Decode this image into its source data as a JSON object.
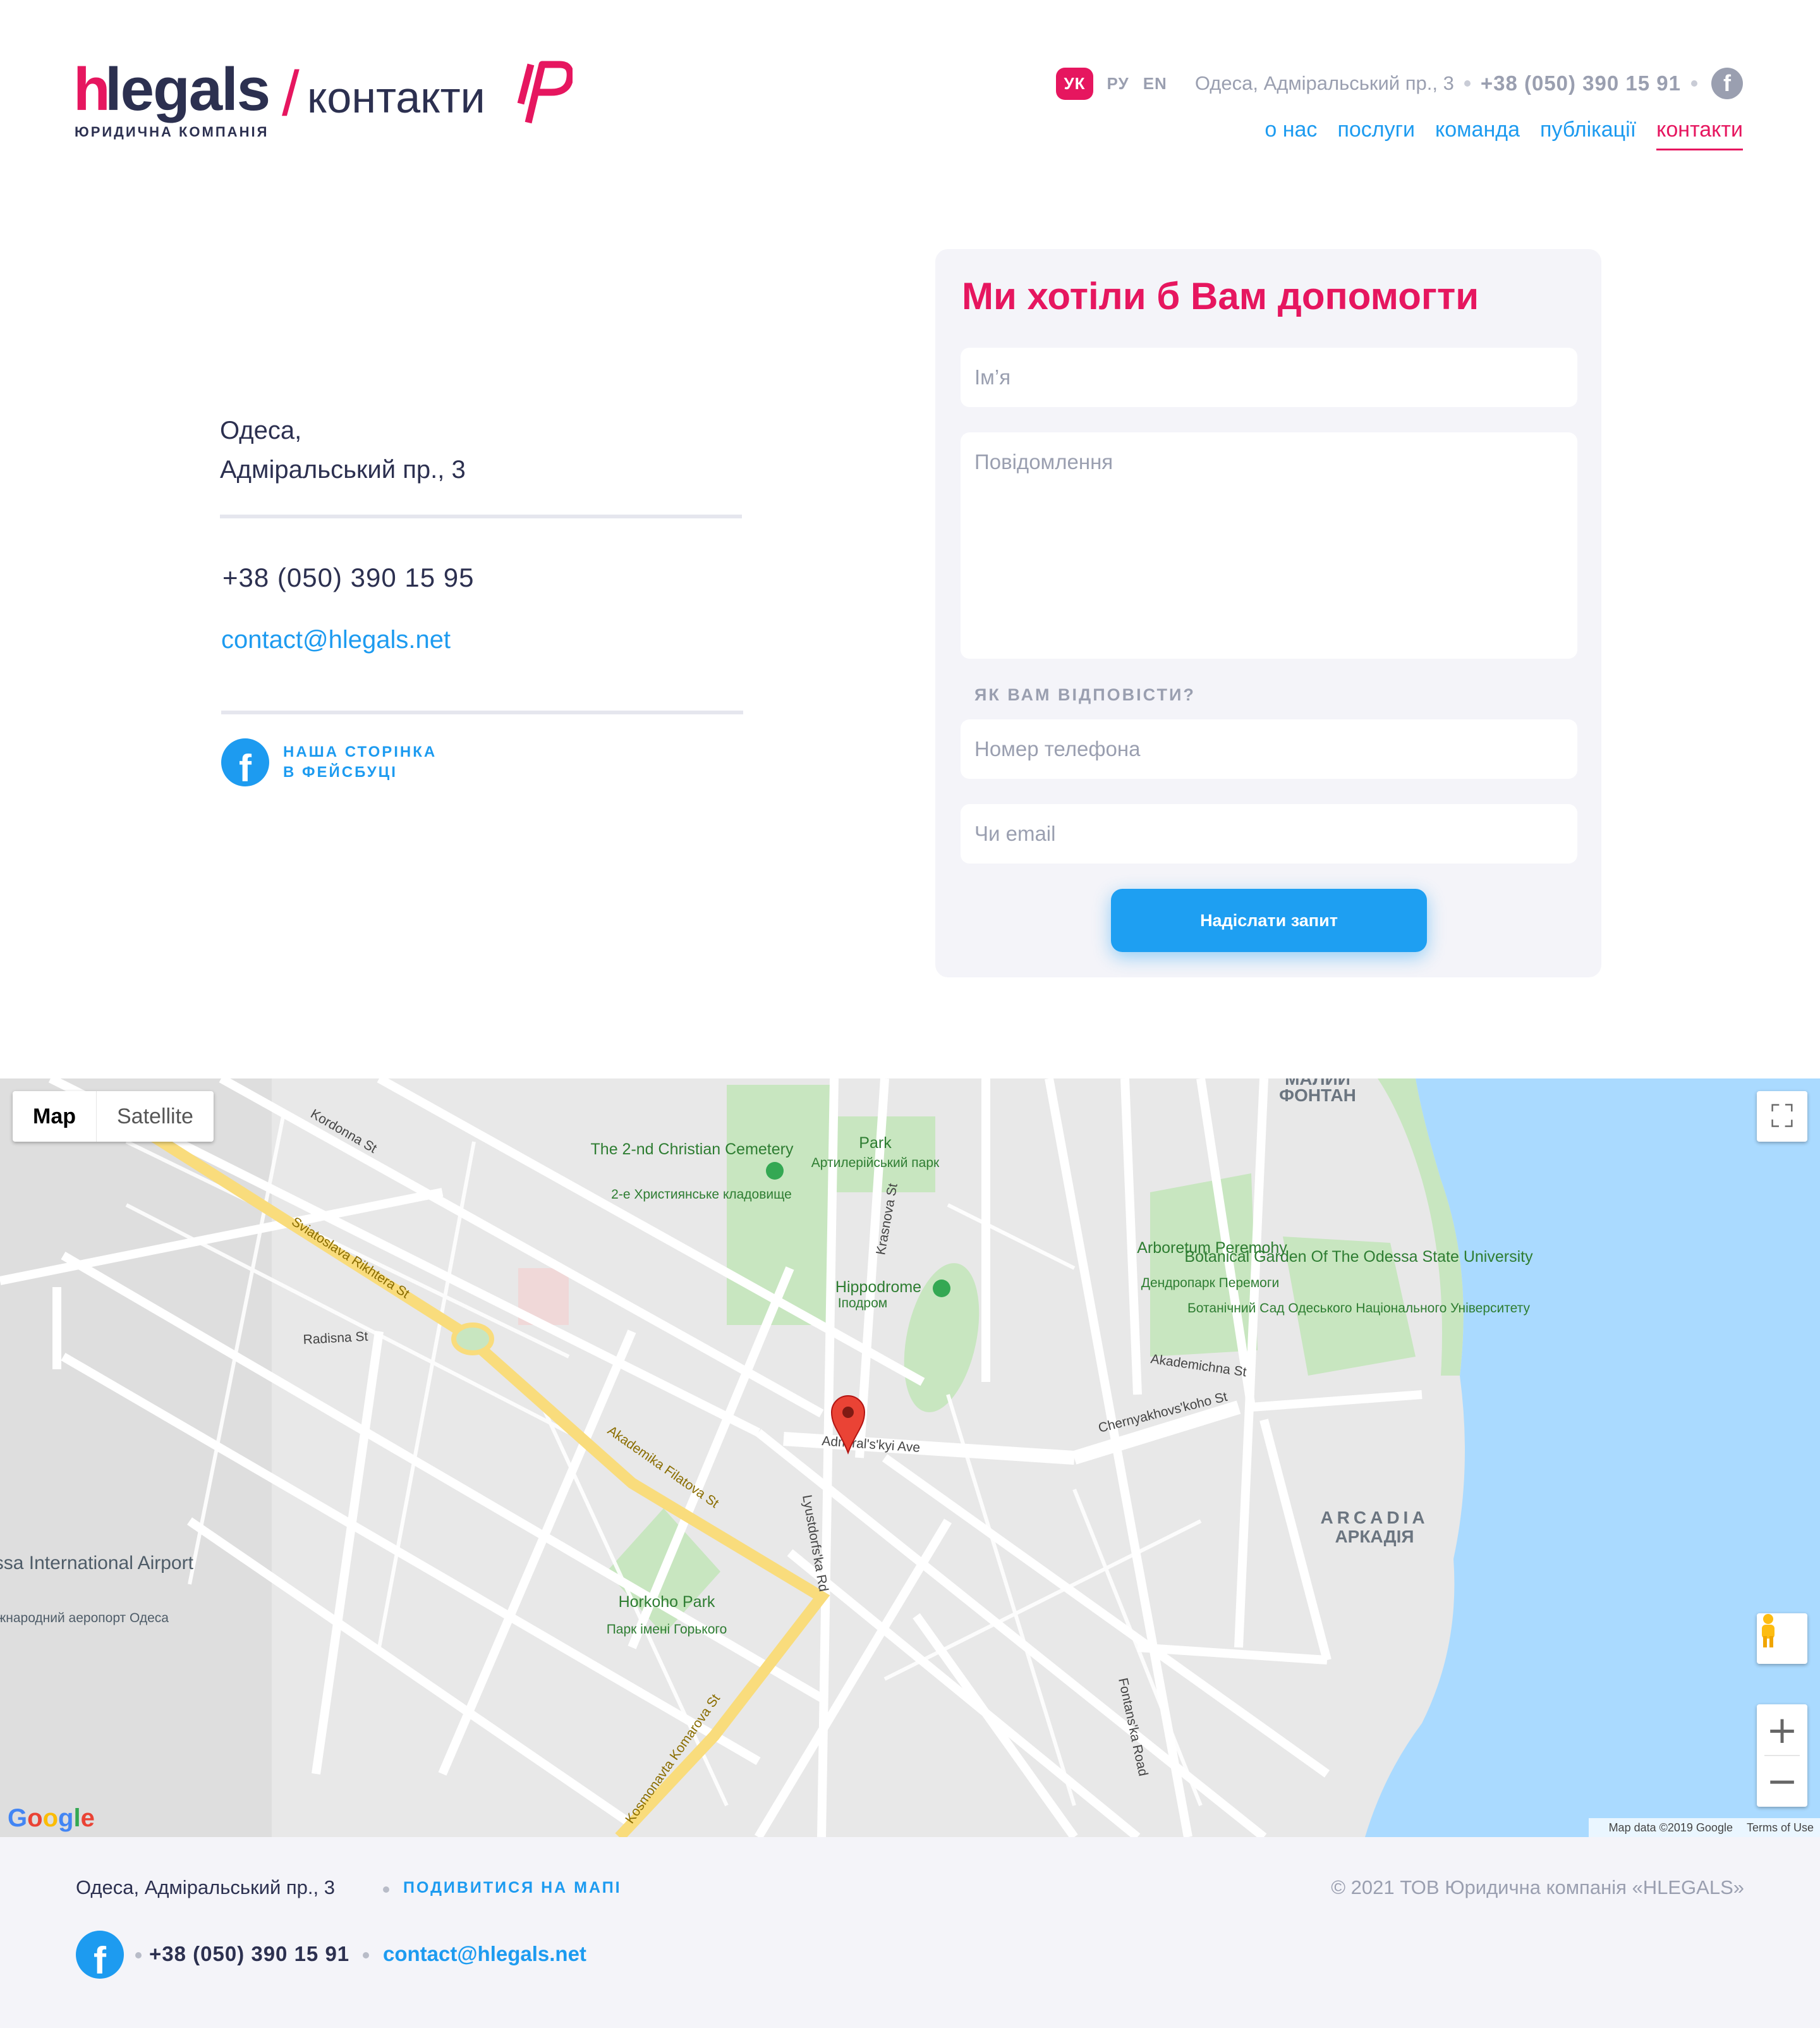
{
  "header": {
    "logo_h": "h",
    "logo_rest": "legals",
    "logo_slash": "/",
    "logo_section": "контакти",
    "logo_subtitle": "ЮРИДИЧНА КОМПАНІЯ",
    "languages": [
      {
        "code": "УК",
        "active": true
      },
      {
        "code": "РУ",
        "active": false
      },
      {
        "code": "EN",
        "active": false
      }
    ],
    "address": "Одеса, Адміральський пр., 3",
    "phone": "+38 (050) 390 15 91",
    "facebook_icon": "facebook-icon"
  },
  "nav": {
    "items": [
      {
        "label": "о нас",
        "active": false
      },
      {
        "label": "послуги",
        "active": false
      },
      {
        "label": "команда",
        "active": false
      },
      {
        "label": "публікації",
        "active": false
      },
      {
        "label": "контакти",
        "active": true
      }
    ]
  },
  "contact": {
    "address_line1": "Одеса,",
    "address_line2": "Адміральський пр., 3",
    "phone": "+38 (050) 390 15 95",
    "email": "contact@hlegals.net",
    "facebook_line1": "НАША СТОРІНКА",
    "facebook_line2": "В ФЕЙСБУЦІ"
  },
  "form": {
    "title": "Ми хотіли б Вам допомогти",
    "name_placeholder": "Ім’я",
    "message_placeholder": "Повідомлення",
    "reply_label": "ЯК ВАМ ВІДПОВІСТИ?",
    "phone_placeholder": "Номер телефона",
    "email_placeholder": "Чи email",
    "submit_label": "Надіслати запит"
  },
  "map": {
    "toggle_map": "Map",
    "toggle_satellite": "Satellite",
    "labels": {
      "cemetery": "The 2-nd Christian Cemetery",
      "cemetery_uk": "2-е Християнське кладовище",
      "park": "Park",
      "park_uk": "Артилерійський парк",
      "hippodrome": "Hippodrome",
      "hippodrome_uk": "Іподром",
      "arboretum": "Arboretum Peremohy",
      "arboretum_uk": "Дендропарк Перемоги",
      "botanical": "Botanical Garden Of The Odessa State University",
      "botanical_uk": "Ботанічний Сад Одеського Національного Університету",
      "fontan": "ФОНТАН",
      "malyi": "МАЛИЙ",
      "arcadia": "ARCADIA",
      "arcadia_uk": "АРКАДІЯ",
      "airport": "Odessa International Airport",
      "airport_uk": "Міжнародний аеропорт Одеса",
      "gorky": "Horkoho Park",
      "gorky_uk": "Парк імені Горького",
      "admiralskyi": "Admiral's'kyi Ave",
      "filatova": "Akademika Filatova St",
      "rikhtera": "Sviatoslava Rikhtera St",
      "komarova": "Kosmonavta Komarova St",
      "fontanska": "Fontans'ka Road",
      "kordonna": "Kordonna St",
      "radisna": "Radisna St",
      "chernyakhovs": "Chernyakhovs'koho St",
      "akademichna": "Akademichna St",
      "krasnova": "Krasnova St",
      "lyustdorfs": "Lyustdorfs'ka Rd"
    },
    "google": "Google",
    "map_data": "Map data ©2019 Google",
    "terms": "Terms of Use"
  },
  "footer": {
    "address": "Одеса, Адміральський пр., 3",
    "map_link": "ПОДИВИТИСЯ НА МАПІ",
    "copyright": "© 2021 ТОВ Юридична компанія «HLEGALS»",
    "phone": "+38 (050) 390 15 91",
    "email": "contact@hlegals.net"
  },
  "colors": {
    "brand_pink": "#e6165f",
    "link_blue": "#1d9bf0",
    "text_dark": "#2c3050",
    "muted": "#9a9fb0",
    "water": "#aadaff",
    "park_green": "#c8e6c0"
  }
}
